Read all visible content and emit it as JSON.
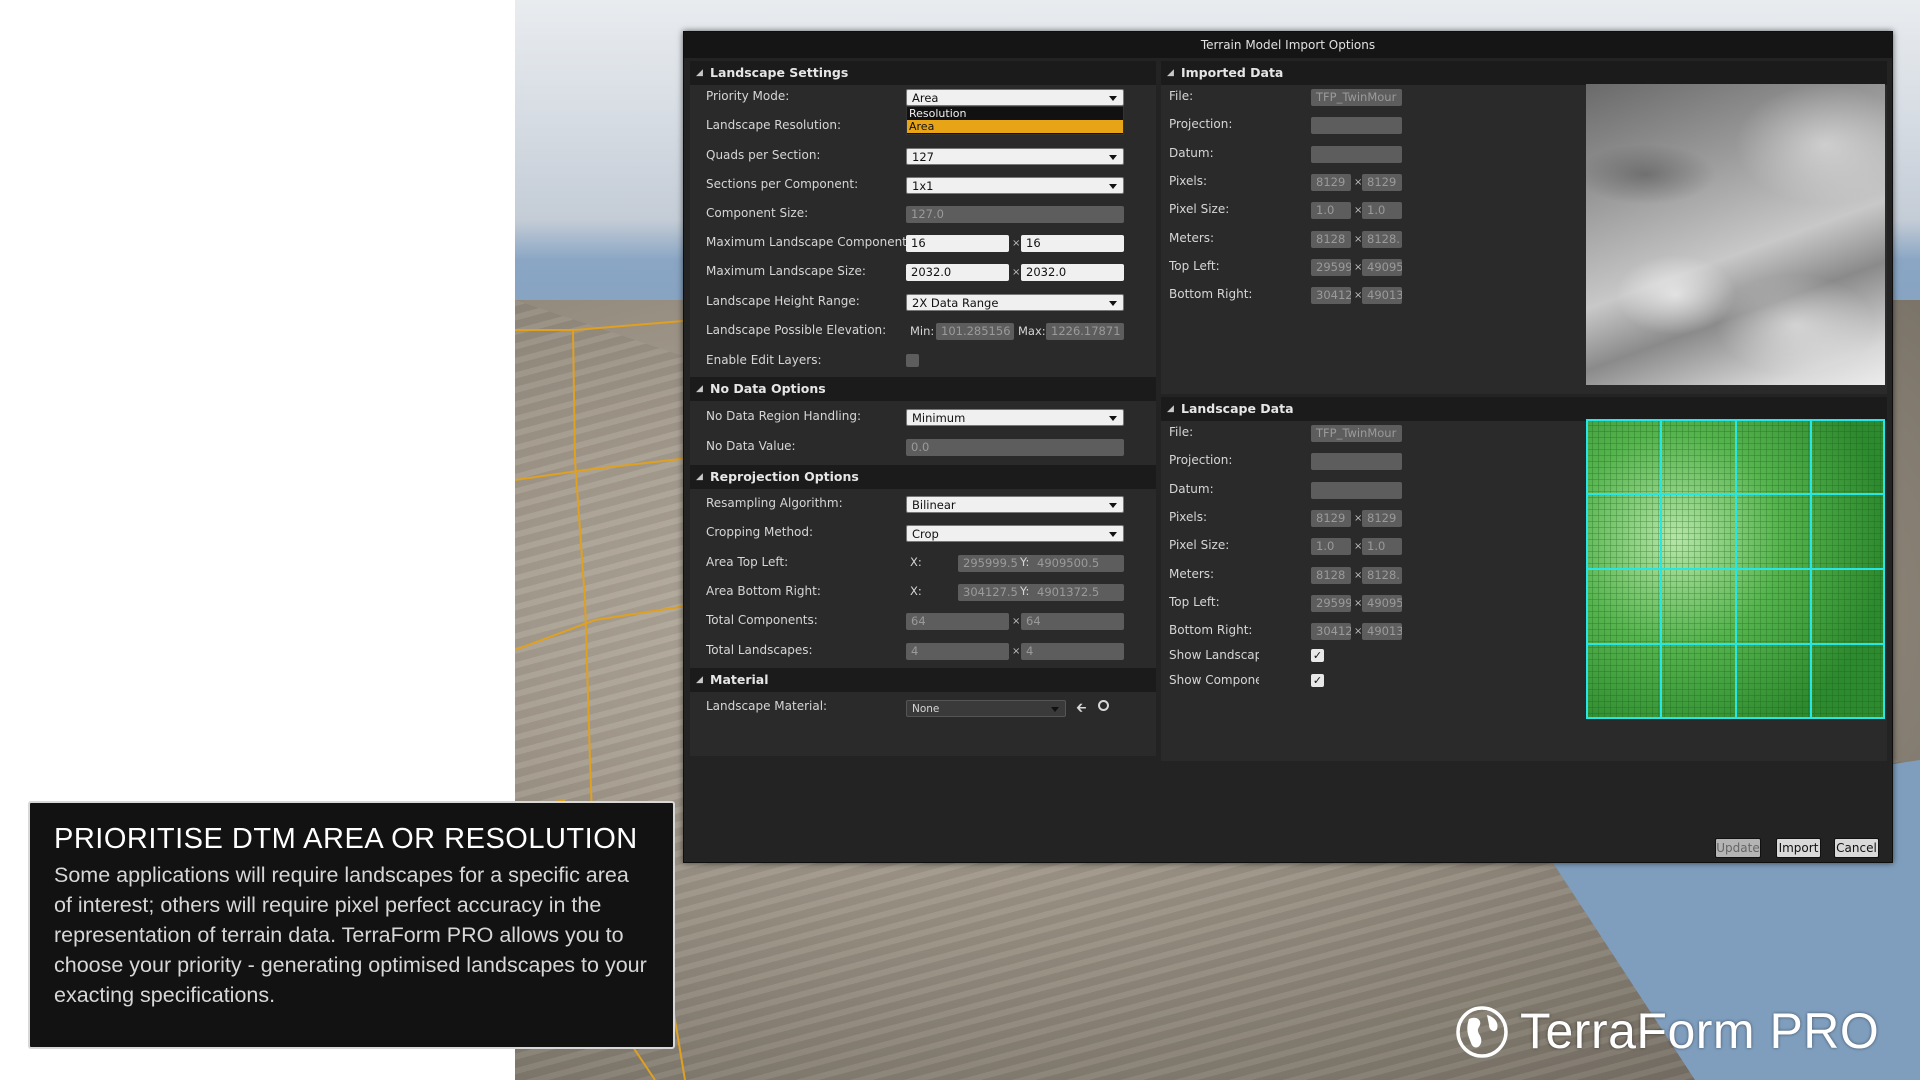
{
  "dialog": {
    "title": "Terrain Model Import Options"
  },
  "landscape_settings": {
    "header": "Landscape Settings",
    "priority_mode": {
      "label": "Priority Mode:",
      "value": "Area",
      "options": [
        "Resolution",
        "Area"
      ],
      "selected_index": 1
    },
    "landscape_resolution": {
      "label": "Landscape Resolution:"
    },
    "quads_per_section": {
      "label": "Quads per Section:",
      "value": "127"
    },
    "sections_per_component": {
      "label": "Sections per Component:",
      "value": "1x1"
    },
    "component_size": {
      "label": "Component Size:",
      "value": "127.0"
    },
    "max_components": {
      "label": "Maximum Landscape Components:",
      "x": "16",
      "y": "16"
    },
    "max_size": {
      "label": "Maximum Landscape Size:",
      "x": "2032.0",
      "y": "2032.0"
    },
    "height_range": {
      "label": "Landscape Height Range:",
      "value": "2X Data Range"
    },
    "possible_elevation": {
      "label": "Landscape Possible Elevation:",
      "min_label": "Min:",
      "min": "101.285156",
      "max_label": "Max:",
      "max": "1226.17871"
    },
    "enable_edit_layers": {
      "label": "Enable Edit Layers:",
      "checked": false
    }
  },
  "no_data_options": {
    "header": "No Data Options",
    "region_handling": {
      "label": "No Data Region Handling:",
      "value": "Minimum"
    },
    "value": {
      "label": "No Data Value:",
      "value": "0.0"
    }
  },
  "reprojection_options": {
    "header": "Reprojection Options",
    "resampling": {
      "label": "Resampling Algorithm:",
      "value": "Bilinear"
    },
    "cropping": {
      "label": "Cropping Method:",
      "value": "Crop"
    },
    "area_top_left": {
      "label": "Area Top Left:",
      "x_label": "X:",
      "x": "295999.5",
      "y_label": "Y:",
      "y": "4909500.5"
    },
    "area_bottom_right": {
      "label": "Area Bottom Right:",
      "x_label": "X:",
      "x": "304127.5",
      "y_label": "Y:",
      "y": "4901372.5"
    },
    "total_components": {
      "label": "Total Components:",
      "x": "64",
      "y": "64"
    },
    "total_landscapes": {
      "label": "Total Landscapes:",
      "x": "4",
      "y": "4"
    }
  },
  "material": {
    "header": "Material",
    "landscape_material": {
      "label": "Landscape Material:",
      "value": "None"
    }
  },
  "imported_data": {
    "header": "Imported Data",
    "rows": [
      {
        "label": "File:",
        "a": "TFP_TwinMour"
      },
      {
        "label": "Projection:",
        "a": ""
      },
      {
        "label": "Datum:",
        "a": ""
      },
      {
        "label": "Pixels:",
        "a": "8129",
        "b": "8129"
      },
      {
        "label": "Pixel Size:",
        "a": "1.0",
        "b": "1.0"
      },
      {
        "label": "Meters:",
        "a": "8128",
        "b": "8128."
      },
      {
        "label": "Top Left:",
        "a": "29599",
        "b": "49095"
      },
      {
        "label": "Bottom Right:",
        "a": "30412",
        "b": "49013"
      }
    ]
  },
  "landscape_data": {
    "header": "Landscape Data",
    "rows": [
      {
        "label": "File:",
        "a": "TFP_TwinMour"
      },
      {
        "label": "Projection:",
        "a": ""
      },
      {
        "label": "Datum:",
        "a": ""
      },
      {
        "label": "Pixels:",
        "a": "8129",
        "b": "8129"
      },
      {
        "label": "Pixel Size:",
        "a": "1.0",
        "b": "1.0"
      },
      {
        "label": "Meters:",
        "a": "8128",
        "b": "8128."
      },
      {
        "label": "Top Left:",
        "a": "29599",
        "b": "49095"
      },
      {
        "label": "Bottom Right:",
        "a": "30412",
        "b": "49013"
      }
    ],
    "show_landscapes": {
      "label": "Show Landscape",
      "checked": true
    },
    "show_components": {
      "label": "Show Componer",
      "checked": true
    }
  },
  "buttons": {
    "update": "Update",
    "import": "Import",
    "cancel": "Cancel"
  },
  "overlay": {
    "title": "PRIORITISE DTM AREA OR RESOLUTION",
    "body": "Some applications will require landscapes for a specific area of interest; others will require pixel perfect accuracy in the representation of terrain data. TerraForm PRO allows you to choose your priority - generating optimised landscapes to your exacting specifications."
  },
  "brand": {
    "name": "TerraForm PRO",
    "icon": "globe-icon"
  },
  "colors": {
    "highlight": "#e7a417",
    "grid_cyan": "#27e6e6",
    "terrain_line": "#e0a020"
  }
}
